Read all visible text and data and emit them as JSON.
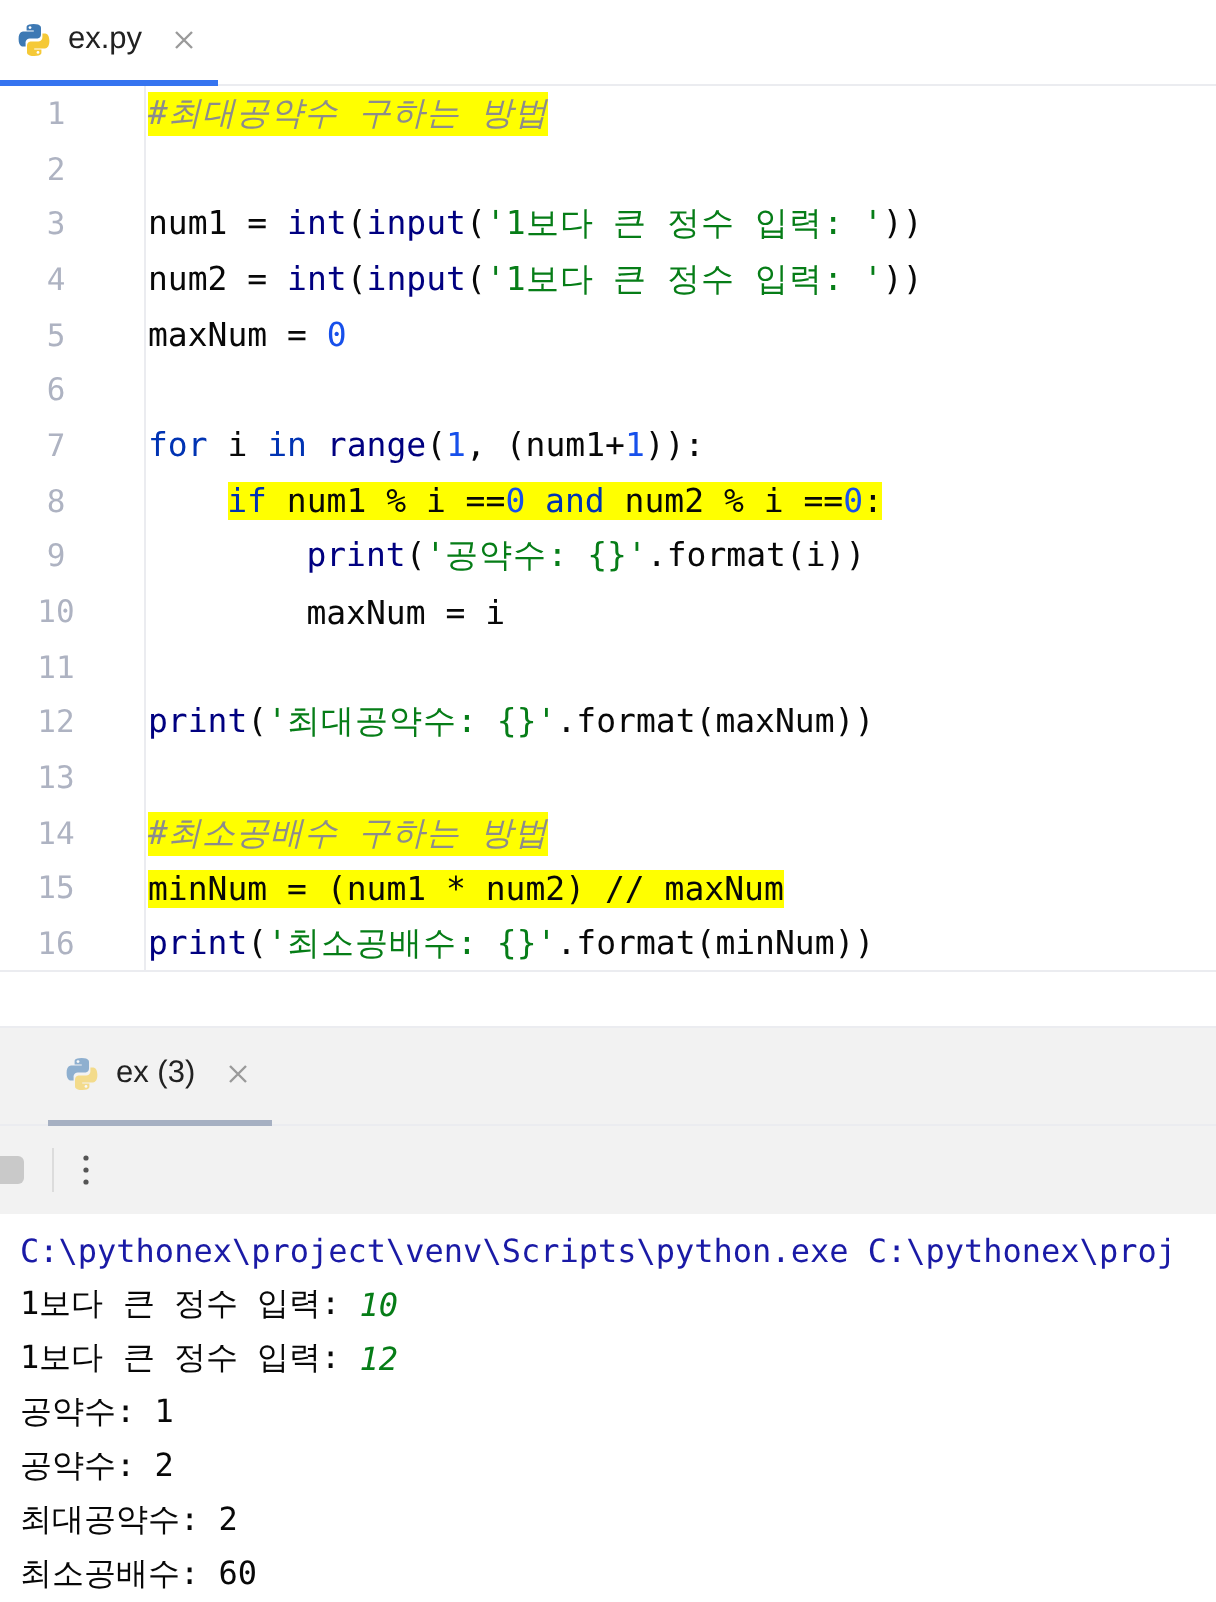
{
  "editor_tabs": [
    {
      "label": "ex.py",
      "selected": true
    }
  ],
  "editor": {
    "lines": [
      {
        "number": "1",
        "highlighted": true,
        "tokens": [
          {
            "kind": "comment",
            "text": "#최대공약수 구하는 방법"
          }
        ]
      },
      {
        "number": "2"
      },
      {
        "number": "3",
        "highlighted": false,
        "tokens": [
          {
            "kind": "plain",
            "text": "num1 = "
          },
          {
            "kind": "builtin",
            "text": "int"
          },
          {
            "kind": "plain",
            "text": "("
          },
          {
            "kind": "builtin",
            "text": "input"
          },
          {
            "kind": "plain",
            "text": "("
          },
          {
            "kind": "string",
            "text": "'1보다 큰 정수 입력: '"
          },
          {
            "kind": "plain",
            "text": "))"
          }
        ]
      },
      {
        "number": "4",
        "highlighted": false,
        "tokens": [
          {
            "kind": "plain",
            "text": "num2 = "
          },
          {
            "kind": "builtin",
            "text": "int"
          },
          {
            "kind": "plain",
            "text": "("
          },
          {
            "kind": "builtin",
            "text": "input"
          },
          {
            "kind": "plain",
            "text": "("
          },
          {
            "kind": "string",
            "text": "'1보다 큰 정수 입력: '"
          },
          {
            "kind": "plain",
            "text": "))"
          }
        ]
      },
      {
        "number": "5",
        "highlighted": false,
        "tokens": [
          {
            "kind": "plain",
            "text": "maxNum = "
          },
          {
            "kind": "number",
            "text": "0"
          }
        ]
      },
      {
        "number": "6"
      },
      {
        "number": "7",
        "highlighted": false,
        "tokens": [
          {
            "kind": "keyword",
            "text": "for"
          },
          {
            "kind": "plain",
            "text": " i "
          },
          {
            "kind": "keyword",
            "text": "in"
          },
          {
            "kind": "builtin",
            "text": " range"
          },
          {
            "kind": "plain",
            "text": "("
          },
          {
            "kind": "number",
            "text": "1"
          },
          {
            "kind": "plain",
            "text": ", (num1+"
          },
          {
            "kind": "number",
            "text": "1"
          },
          {
            "kind": "plain",
            "text": ")):"
          }
        ],
        "children": [
          {
            "number": "8",
            "highlighted": true,
            "tokens": [
              {
                "kind": "keyword",
                "text": "if"
              },
              {
                "kind": "plain",
                "text": " num1 % i =="
              },
              {
                "kind": "number",
                "text": "0"
              },
              {
                "kind": "keyword",
                "text": " and"
              },
              {
                "kind": "plain",
                "text": " num2 % i =="
              },
              {
                "kind": "number",
                "text": "0"
              },
              {
                "kind": "plain",
                "text": ":"
              }
            ],
            "children": [
              {
                "number": "9",
                "highlighted": false,
                "tokens": [
                  {
                    "kind": "builtin",
                    "text": "print"
                  },
                  {
                    "kind": "plain",
                    "text": "("
                  },
                  {
                    "kind": "string",
                    "text": "'공약수: {}'"
                  },
                  {
                    "kind": "plain",
                    "text": ".format(i))"
                  }
                ]
              },
              {
                "number": "10",
                "highlighted": false,
                "tokens": [
                  {
                    "kind": "plain",
                    "text": "maxNum = i"
                  }
                ]
              }
            ]
          }
        ]
      },
      {
        "number": "11"
      },
      {
        "number": "12",
        "highlighted": false,
        "tokens": [
          {
            "kind": "builtin",
            "text": "print"
          },
          {
            "kind": "plain",
            "text": "("
          },
          {
            "kind": "string",
            "text": "'최대공약수: {}'"
          },
          {
            "kind": "plain",
            "text": ".format(maxNum))"
          }
        ]
      },
      {
        "number": "13"
      },
      {
        "number": "14",
        "highlighted": true,
        "tokens": [
          {
            "kind": "comment",
            "text": "#최소공배수 구하는 방법"
          }
        ]
      },
      {
        "number": "15",
        "highlighted": true,
        "tokens": [
          {
            "kind": "plain",
            "text": "minNum = (num1 * num2) // maxNum"
          }
        ]
      },
      {
        "number": "16",
        "highlighted": false,
        "tokens": [
          {
            "kind": "builtin",
            "text": "print"
          },
          {
            "kind": "plain",
            "text": "("
          },
          {
            "kind": "string",
            "text": "'최소공배수: {}'"
          },
          {
            "kind": "plain",
            "text": ".format(minNum))"
          }
        ]
      }
    ]
  },
  "run_tabs": [
    {
      "label": "ex (3)",
      "selected": true
    }
  ],
  "console": {
    "lines": [
      {
        "tokens": [
          {
            "kind": "command",
            "text": "C:\\pythonex\\project\\venv\\Scripts\\python.exe C:\\pythonex\\proj"
          }
        ]
      },
      {
        "tokens": [
          {
            "kind": "output",
            "text": "1보다 큰 정수 입력: "
          },
          {
            "kind": "input",
            "text": "10"
          }
        ]
      },
      {
        "tokens": [
          {
            "kind": "output",
            "text": "1보다 큰 정수 입력: "
          },
          {
            "kind": "input",
            "text": "12"
          }
        ]
      },
      {
        "tokens": [
          {
            "kind": "output",
            "text": "공약수: 1"
          }
        ]
      },
      {
        "tokens": [
          {
            "kind": "output",
            "text": "공약수: 2"
          }
        ]
      },
      {
        "tokens": [
          {
            "kind": "output",
            "text": "최대공약수: 2"
          }
        ]
      },
      {
        "tokens": [
          {
            "kind": "output",
            "text": "최소공배수: 60"
          }
        ]
      }
    ]
  }
}
